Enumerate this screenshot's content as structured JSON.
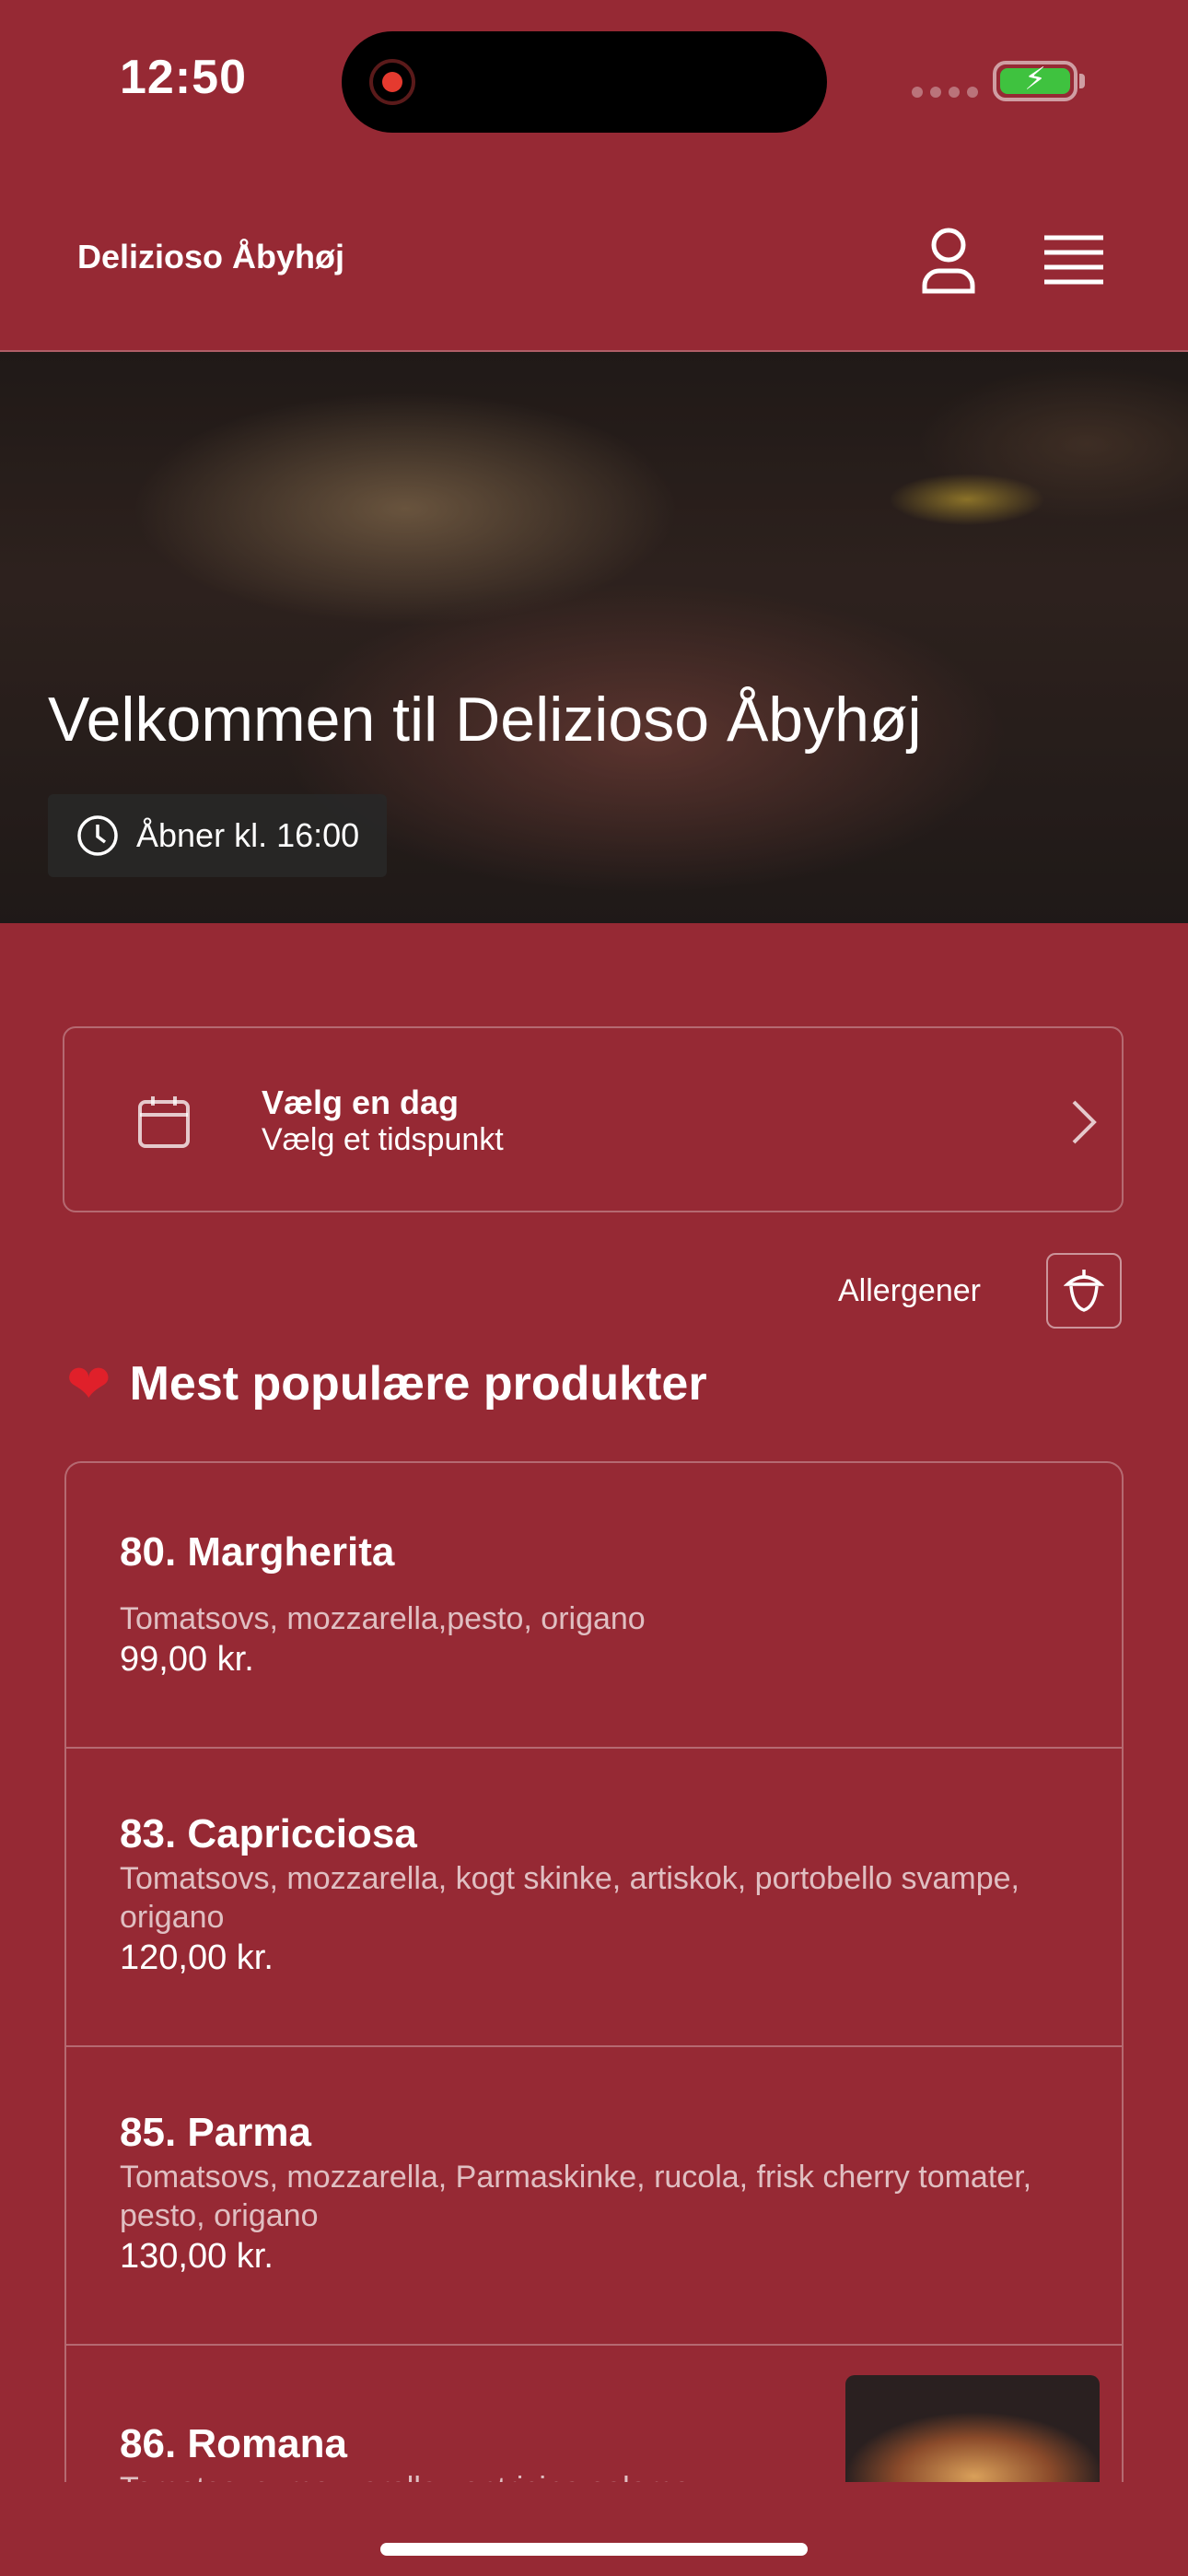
{
  "status_bar": {
    "time": "12:50"
  },
  "header": {
    "brand": "Delizioso Åbyhøj",
    "profile_icon": "user-icon",
    "menu_icon": "hamburger-menu-icon"
  },
  "hero": {
    "title": "Velkommen til Delizioso Åbyhøj",
    "opening": "Åbner kl. 16:00"
  },
  "date_picker": {
    "day_label": "Vælg en dag",
    "time_label": "Vælg et tidspunkt"
  },
  "allergens": {
    "label": "Allergener"
  },
  "section": {
    "heading": "Mest populære produkter"
  },
  "products": [
    {
      "name": "80. Margherita",
      "description": "Tomatsovs, mozzarella,pesto, origano",
      "price": "99,00 kr."
    },
    {
      "name": "83. Capricciosa",
      "description": "Tomatsovs, mozzarella, kogt skinke, artiskok, portobello svampe, origano",
      "price": "120,00 kr."
    },
    {
      "name": "85. Parma",
      "description": "Tomatsovs, mozzarella, Parmaskinke, rucola, frisk cherry tomater, pesto, origano",
      "price": "130,00 kr."
    },
    {
      "name": "86. Romana",
      "description": "Tomatsovs, mozzarella ventricina salame",
      "price": ""
    }
  ],
  "colors": {
    "background": "#962934",
    "accent_heart": "#e0202a"
  }
}
